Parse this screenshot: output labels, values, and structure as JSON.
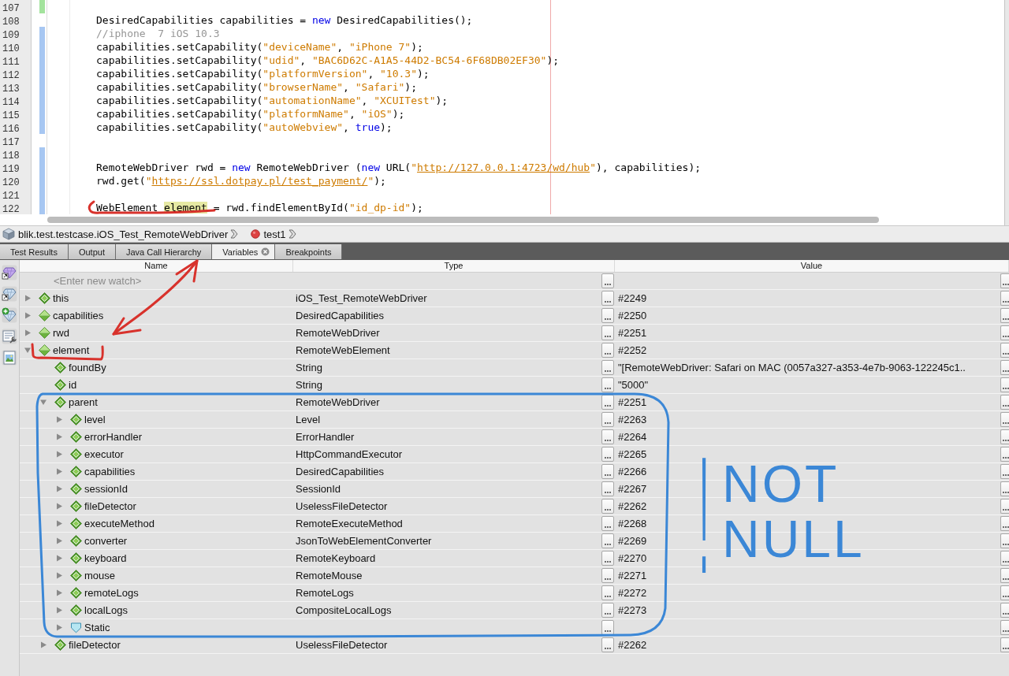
{
  "editor": {
    "lines": [
      {
        "number": "107",
        "color": "#a3e39d"
      },
      {
        "number": "108",
        "tokens": [
          {
            "kind": "plain",
            "text": "DesiredCapabilities capabilities = "
          },
          {
            "kind": "keyword",
            "text": "new"
          },
          {
            "kind": "plain",
            "text": " DesiredCapabilities();"
          }
        ]
      },
      {
        "number": "109",
        "color": "#a7c7f2",
        "tokens": [
          {
            "kind": "comment",
            "text": "//iphone  7 iOS 10.3"
          }
        ]
      },
      {
        "number": "110",
        "color": "#a7c7f2",
        "tokens": [
          {
            "kind": "plain",
            "text": "capabilities.setCapability("
          },
          {
            "kind": "string",
            "text": "\"deviceName\""
          },
          {
            "kind": "plain",
            "text": ", "
          },
          {
            "kind": "string",
            "text": "\"iPhone 7\""
          },
          {
            "kind": "plain",
            "text": ");"
          }
        ]
      },
      {
        "number": "111",
        "color": "#a7c7f2",
        "tokens": [
          {
            "kind": "plain",
            "text": "capabilities.setCapability("
          },
          {
            "kind": "string",
            "text": "\"udid\""
          },
          {
            "kind": "plain",
            "text": ", "
          },
          {
            "kind": "string",
            "text": "\"BAC6D62C-A1A5-44D2-BC54-6F68DB02EF30\""
          },
          {
            "kind": "plain",
            "text": ");"
          }
        ]
      },
      {
        "number": "112",
        "color": "#a7c7f2",
        "tokens": [
          {
            "kind": "plain",
            "text": "capabilities.setCapability("
          },
          {
            "kind": "string",
            "text": "\"platformVersion\""
          },
          {
            "kind": "plain",
            "text": ", "
          },
          {
            "kind": "string",
            "text": "\"10.3\""
          },
          {
            "kind": "plain",
            "text": ");"
          }
        ]
      },
      {
        "number": "113",
        "color": "#a7c7f2",
        "tokens": [
          {
            "kind": "plain",
            "text": "capabilities.setCapability("
          },
          {
            "kind": "string",
            "text": "\"browserName\""
          },
          {
            "kind": "plain",
            "text": ", "
          },
          {
            "kind": "string",
            "text": "\"Safari\""
          },
          {
            "kind": "plain",
            "text": ");"
          }
        ]
      },
      {
        "number": "114",
        "color": "#a7c7f2",
        "tokens": [
          {
            "kind": "plain",
            "text": "capabilities.setCapability("
          },
          {
            "kind": "string",
            "text": "\"automationName\""
          },
          {
            "kind": "plain",
            "text": ", "
          },
          {
            "kind": "string",
            "text": "\"XCUITest\""
          },
          {
            "kind": "plain",
            "text": ");"
          }
        ]
      },
      {
        "number": "115",
        "color": "#a7c7f2",
        "tokens": [
          {
            "kind": "plain",
            "text": "capabilities.setCapability("
          },
          {
            "kind": "string",
            "text": "\"platformName\""
          },
          {
            "kind": "plain",
            "text": ", "
          },
          {
            "kind": "string",
            "text": "\"iOS\""
          },
          {
            "kind": "plain",
            "text": ");"
          }
        ]
      },
      {
        "number": "116",
        "color": "#a7c7f2",
        "tokens": [
          {
            "kind": "plain",
            "text": "capabilities.setCapability("
          },
          {
            "kind": "string",
            "text": "\"autoWebview\""
          },
          {
            "kind": "plain",
            "text": ", "
          },
          {
            "kind": "keyword",
            "text": "true"
          },
          {
            "kind": "plain",
            "text": ");"
          }
        ]
      },
      {
        "number": "117"
      },
      {
        "number": "118",
        "color": "#a7c7f2"
      },
      {
        "number": "119",
        "color": "#a7c7f2",
        "tokens": [
          {
            "kind": "plain",
            "text": "RemoteWebDriver rwd = "
          },
          {
            "kind": "keyword",
            "text": "new"
          },
          {
            "kind": "plain",
            "text": " RemoteWebDriver ("
          },
          {
            "kind": "keyword",
            "text": "new"
          },
          {
            "kind": "plain",
            "text": " URL("
          },
          {
            "kind": "string",
            "text": "\""
          },
          {
            "kind": "link",
            "text": "http://127.0.0.1:4723/wd/hub"
          },
          {
            "kind": "string",
            "text": "\""
          },
          {
            "kind": "plain",
            "text": "), capabilities);"
          }
        ]
      },
      {
        "number": "120",
        "color": "#a7c7f2",
        "tokens": [
          {
            "kind": "plain",
            "text": "rwd.get("
          },
          {
            "kind": "string",
            "text": "\""
          },
          {
            "kind": "link",
            "text": "https://ssl.dotpay.pl/test_payment/"
          },
          {
            "kind": "string",
            "text": "\""
          },
          {
            "kind": "plain",
            "text": ");"
          }
        ]
      },
      {
        "number": "121",
        "color": "#a7c7f2"
      },
      {
        "number": "122",
        "color": "#a7c7f2",
        "tokens": [
          {
            "kind": "plain",
            "text": "WebElement "
          },
          {
            "kind": "highlight",
            "text": "element"
          },
          {
            "kind": "plain",
            "text": " = rwd.findElementById("
          },
          {
            "kind": "string",
            "text": "\"id_dp-id\""
          },
          {
            "kind": "plain",
            "text": ");"
          }
        ]
      }
    ]
  },
  "breadcrumb": [
    {
      "kind": "class",
      "label": "blik.test.testcase.iOS_Test_RemoteWebDriver"
    },
    {
      "kind": "method",
      "label": "test1"
    }
  ],
  "tabs": [
    {
      "label": "Test Results",
      "selected": false
    },
    {
      "label": "Output",
      "selected": false
    },
    {
      "label": "Java Call Hierarchy",
      "selected": false
    },
    {
      "label": "Variables",
      "selected": true
    },
    {
      "label": "Breakpoints",
      "selected": false
    }
  ],
  "variables": {
    "columns": [
      "Name",
      "Type",
      "Value"
    ],
    "new_watch": "<Enter new watch>",
    "rows": [
      {
        "kind": "field",
        "name": "this",
        "type": "iOS_Test_RemoteWebDriver",
        "value": "#2249",
        "expanded": false
      },
      {
        "kind": "local",
        "name": "capabilities",
        "type": "DesiredCapabilities",
        "value": "#2250",
        "expanded": false
      },
      {
        "kind": "local",
        "name": "rwd",
        "type": "RemoteWebDriver",
        "value": "#2251",
        "expanded": false
      },
      {
        "kind": "local",
        "name": "element",
        "type": "RemoteWebElement",
        "value": "#2252",
        "expanded": true,
        "children": [
          {
            "kind": "field",
            "name": "foundBy",
            "type": "String",
            "value": "\"[RemoteWebDriver: Safari on MAC (0057a327-a353-4e7b-9063-122245c1.."
          },
          {
            "kind": "field",
            "name": "id",
            "type": "String",
            "value": "\"5000\""
          },
          {
            "kind": "field",
            "name": "parent",
            "type": "RemoteWebDriver",
            "value": "#2251",
            "expanded": true,
            "children": [
              {
                "kind": "field",
                "name": "level",
                "type": "Level",
                "value": "#2263",
                "expanded": false
              },
              {
                "kind": "field",
                "name": "errorHandler",
                "type": "ErrorHandler",
                "value": "#2264",
                "expanded": false
              },
              {
                "kind": "field",
                "name": "executor",
                "type": "HttpCommandExecutor",
                "value": "#2265",
                "expanded": false
              },
              {
                "kind": "field",
                "name": "capabilities",
                "type": "DesiredCapabilities",
                "value": "#2266",
                "expanded": false
              },
              {
                "kind": "field",
                "name": "sessionId",
                "type": "SessionId",
                "value": "#2267",
                "expanded": false
              },
              {
                "kind": "field",
                "name": "fileDetector",
                "type": "UselessFileDetector",
                "value": "#2262",
                "expanded": false
              },
              {
                "kind": "field",
                "name": "executeMethod",
                "type": "RemoteExecuteMethod",
                "value": "#2268",
                "expanded": false
              },
              {
                "kind": "field",
                "name": "converter",
                "type": "JsonToWebElementConverter",
                "value": "#2269",
                "expanded": false
              },
              {
                "kind": "field",
                "name": "keyboard",
                "type": "RemoteKeyboard",
                "value": "#2270",
                "expanded": false
              },
              {
                "kind": "field",
                "name": "mouse",
                "type": "RemoteMouse",
                "value": "#2271",
                "expanded": false
              },
              {
                "kind": "field",
                "name": "remoteLogs",
                "type": "RemoteLogs",
                "value": "#2272",
                "expanded": false
              },
              {
                "kind": "field",
                "name": "localLogs",
                "type": "CompositeLocalLogs",
                "value": "#2273",
                "expanded": false
              },
              {
                "kind": "static",
                "name": "Static",
                "expanded": false
              }
            ]
          },
          {
            "kind": "field",
            "name": "fileDetector",
            "type": "UselessFileDetector",
            "value": "#2262",
            "expanded": false
          }
        ]
      }
    ]
  },
  "annotations": [
    {
      "kind": "underline",
      "color": "#d8322c"
    },
    {
      "kind": "double-arrow",
      "color": "#d8322c"
    },
    {
      "kind": "bracket",
      "color": "#d8322c"
    },
    {
      "kind": "frame",
      "color": "#3b87d6"
    },
    {
      "kind": "note",
      "color": "#3b87d6",
      "mark": "!",
      "lines": [
        "NOT",
        "NULL"
      ]
    }
  ]
}
